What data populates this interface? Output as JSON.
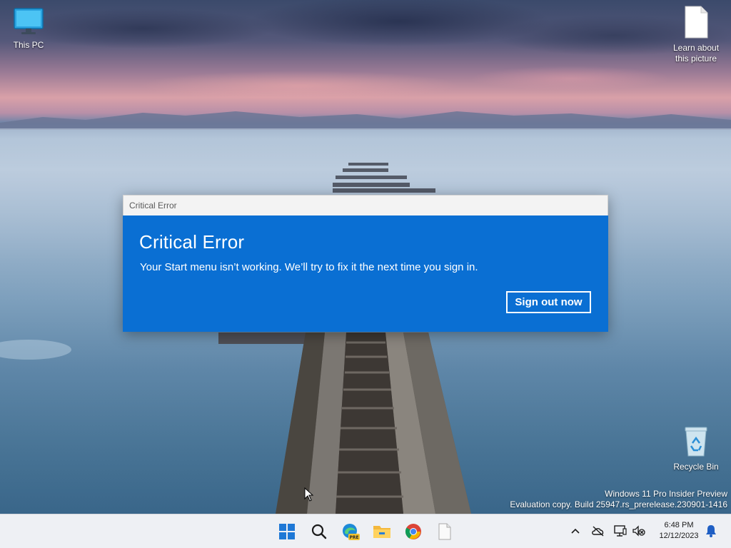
{
  "desktop": {
    "icons": [
      {
        "label": "This PC",
        "icon": "monitor-icon"
      },
      {
        "label": "Learn about this picture",
        "icon": "document-icon"
      },
      {
        "label": "Recycle Bin",
        "icon": "recycle-bin-icon"
      }
    ],
    "watermark": {
      "line1": "Windows 11 Pro Insider Preview",
      "line2": "Evaluation copy. Build 25947.rs_prerelease.230901-1416"
    }
  },
  "dialog": {
    "window_title": "Critical Error",
    "heading": "Critical Error",
    "message": "Your Start menu isn’t working. We’ll try to fix it the next time you sign in.",
    "button_label": "Sign out now",
    "accent_color": "#0a6fd3"
  },
  "taskbar": {
    "apps": [
      {
        "name": "Start",
        "icon": "windows-logo-icon"
      },
      {
        "name": "Search",
        "icon": "search-icon"
      },
      {
        "name": "Microsoft Edge Preview",
        "icon": "edge-pre-icon",
        "badge": "PRE"
      },
      {
        "name": "File Explorer",
        "icon": "folder-icon"
      },
      {
        "name": "Google Chrome",
        "icon": "chrome-icon"
      },
      {
        "name": "Notepad",
        "icon": "document-icon"
      }
    ],
    "tray": {
      "icons": [
        "chevron-up-icon",
        "onedrive-offline-icon",
        "network-icon",
        "volume-muted-icon"
      ],
      "time": "6:48 PM",
      "date": "12/12/2023",
      "notification_icon": "bell-icon"
    }
  }
}
